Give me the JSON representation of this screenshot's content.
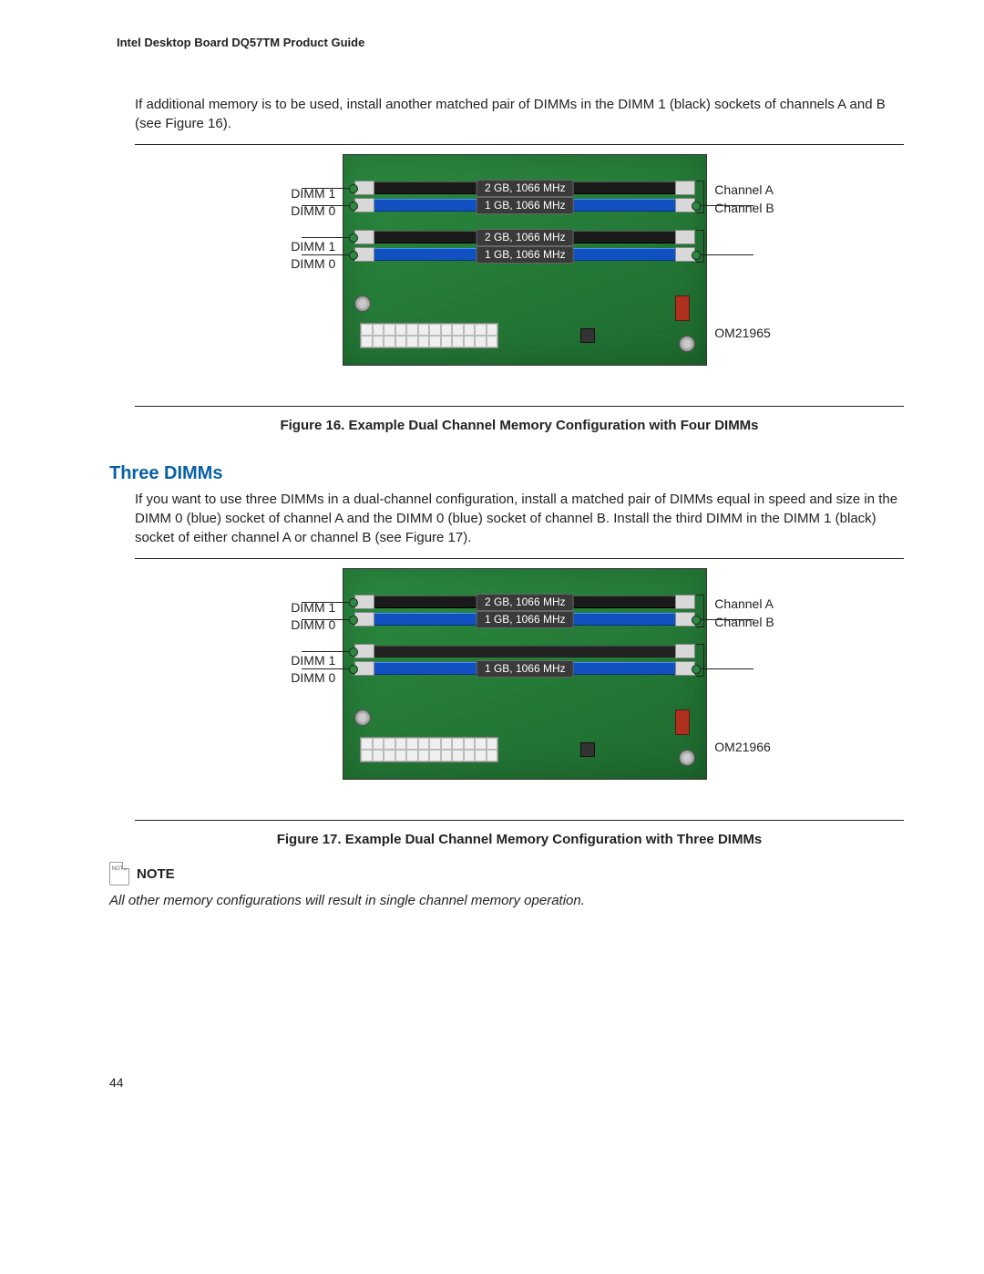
{
  "header": "Intel Desktop Board DQ57TM Product Guide",
  "intro": "If additional memory is to be used, install another matched pair of DIMMs in the DIMM 1 (black) sockets of channels A and B (see Figure 16).",
  "fig16": {
    "caption": "Figure 16.  Example Dual Channel Memory Configuration with Four DIMMs",
    "code": "OM21965",
    "left": {
      "d1": "DIMM 1",
      "d0": "DIMM 0"
    },
    "right": {
      "chA": "Channel A",
      "chB": "Channel B"
    },
    "slots": {
      "a1": "2 GB, 1066 MHz",
      "a0": "1 GB, 1066 MHz",
      "b1": "2 GB, 1066 MHz",
      "b0": "1 GB, 1066 MHz"
    }
  },
  "three_heading": "Three DIMMs",
  "three_body": "If you want to use three DIMMs in a dual-channel configuration, install a matched pair of DIMMs equal in speed and size in the DIMM 0 (blue) socket of channel A and the DIMM 0 (blue) socket of channel B.  Install the third DIMM in the DIMM 1 (black) socket of either channel A or channel B (see Figure 17).",
  "fig17": {
    "caption": "Figure 17.  Example Dual Channel Memory Configuration with Three DIMMs",
    "code": "OM21966",
    "left": {
      "d1": "DIMM 1",
      "d0": "DIMM 0"
    },
    "right": {
      "chA": "Channel A",
      "chB": "Channel B"
    },
    "slots": {
      "a1": "2 GB, 1066 MHz",
      "a0": "1 GB, 1066 MHz",
      "b1": "",
      "b0": "1 GB, 1066 MHz"
    }
  },
  "note": {
    "label": "NOTE",
    "iconText": "NOTE",
    "text": "All other memory configurations will result in single channel memory operation."
  },
  "page": "44"
}
